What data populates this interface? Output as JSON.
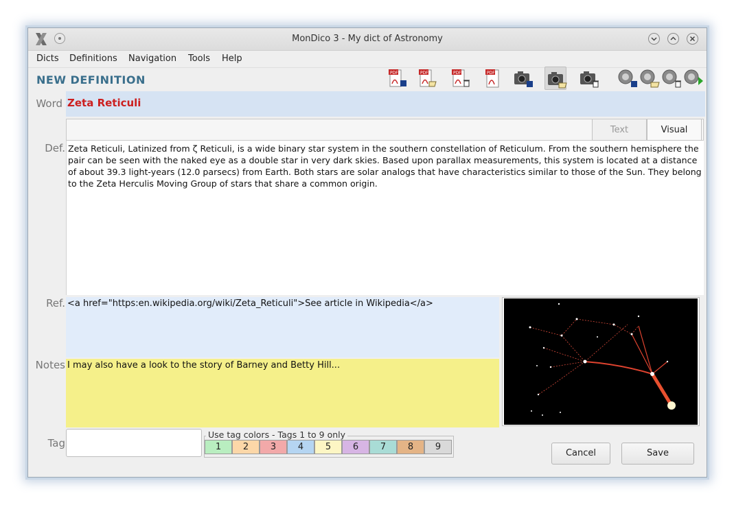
{
  "window": {
    "title": "MonDico 3 - My dict of Astronomy"
  },
  "menu": {
    "items": [
      "Dicts",
      "Definitions",
      "Navigation",
      "Tools",
      "Help"
    ]
  },
  "form": {
    "heading": "NEW DEFINITION",
    "word_label": "Word",
    "word_value": "Zeta Reticuli",
    "def_label": "Def.",
    "tabs": {
      "text": "Text",
      "visual": "Visual",
      "active": "Visual"
    },
    "definition": "Zeta Reticuli, Latinized from ζ Reticuli, is a wide binary star system in the southern constellation of Reticulum. From the southern hemisphere the pair can be seen with the naked eye as a double star in very dark skies. Based upon parallax measurements, this system is located at a distance of about 39.3 light-years (12.0 parsecs) from Earth. Both stars are solar analogs that have characteristics similar to those of the Sun. They belong to the Zeta Herculis Moving Group of stars that share a common origin.",
    "ref_label": "Ref.",
    "ref_value": "<a href=\"https:en.wikipedia.org/wiki/Zeta_Reticuli\">See article in Wikipedia</a>",
    "notes_label": "Notes",
    "notes_value": "I may also have a look to the story of Barney and Betty Hill...",
    "tag_label": "Tag",
    "tag_value": "",
    "tag_group_title": "Use tag colors - Tags 1 to 9 only",
    "tags": [
      {
        "label": "1",
        "color": "#b9eec0"
      },
      {
        "label": "2",
        "color": "#fcd7a8"
      },
      {
        "label": "3",
        "color": "#f2a9a9"
      },
      {
        "label": "4",
        "color": "#b5d5f2"
      },
      {
        "label": "5",
        "color": "#fdf6c4"
      },
      {
        "label": "6",
        "color": "#d7b5e4"
      },
      {
        "label": "7",
        "color": "#a9dcd6"
      },
      {
        "label": "8",
        "color": "#e4b486"
      },
      {
        "label": "9",
        "color": "#d9d9d9"
      }
    ]
  },
  "toolbar": {
    "buttons": [
      {
        "name": "pdf-save-icon"
      },
      {
        "name": "pdf-open-icon"
      },
      {
        "name": "pdf-delete-icon"
      },
      {
        "name": "pdf-view-icon"
      },
      {
        "name": "camera-save-icon"
      },
      {
        "name": "camera-open-icon"
      },
      {
        "name": "camera-delete-icon"
      },
      {
        "name": "speaker-save-icon"
      },
      {
        "name": "speaker-open-icon"
      },
      {
        "name": "speaker-delete-icon"
      },
      {
        "name": "speaker-play-icon"
      }
    ]
  },
  "buttons": {
    "cancel": "Cancel",
    "save": "Save"
  },
  "colors": {
    "heading": "#3a6f8c",
    "word": "#cc1f1f",
    "word_bg": "#d6e3f3",
    "ref_bg": "#e1ecfa",
    "notes_bg": "#f5f08a"
  }
}
